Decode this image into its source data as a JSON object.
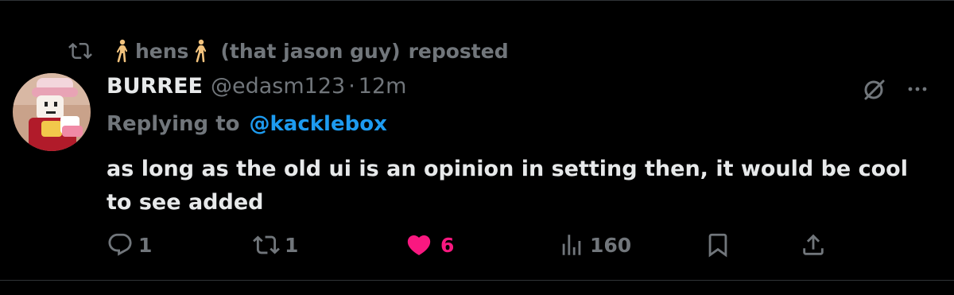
{
  "repost": {
    "reposter_name": "hens",
    "reposter_suffix": "(that jason guy)",
    "action": "reposted"
  },
  "tweet": {
    "display_name": "BURREE",
    "handle": "@edasm123",
    "separator": "·",
    "timestamp": "12m",
    "replying_to_label": "Replying to",
    "replying_to_handle": "@kacklebox",
    "text": "as long as the old ui is an opinion in setting then, it would be cool to see added"
  },
  "actions": {
    "replies": "1",
    "reposts": "1",
    "likes": "6",
    "views": "160"
  },
  "colors": {
    "background": "#000000",
    "primary_text": "#e7e9ea",
    "secondary_text": "#71767b",
    "mention_blue": "#1d9bf0",
    "like_pink": "#f91880",
    "border": "#2f3336"
  },
  "icons": {
    "repost": "repost-icon",
    "walker": "person-walking-icon",
    "grok": "grok-icon",
    "more": "more-icon",
    "reply": "reply-icon",
    "like": "heart-icon",
    "views": "views-icon",
    "bookmark": "bookmark-icon",
    "share": "share-icon"
  }
}
